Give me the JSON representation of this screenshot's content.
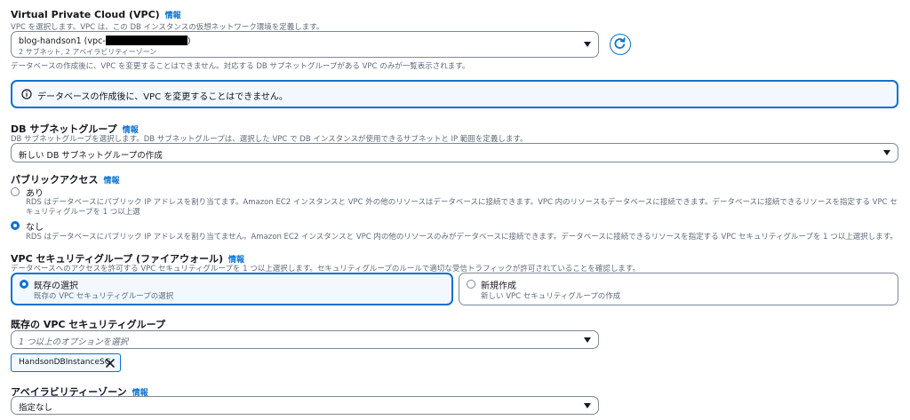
{
  "vpc": {
    "label": "Virtual Private Cloud (VPC)",
    "info": "情報",
    "description": "VPC を選択します。VPC は、この DB インスタンスの仮想ネットワーク環境を定義します。",
    "selected_value": "blog-handson1 (vpc-",
    "selected_sub": "2 サブネット, 2 アベイラビリティーゾーン",
    "footnote": "データベースの作成後に、VPC を変更することはできません。対応する DB サブネットグループがある VPC のみが一覧表示されます。"
  },
  "alert": {
    "text": "データベースの作成後に、VPC を変更することはできません。"
  },
  "subnet_group": {
    "label": "DB サブネットグループ",
    "info": "情報",
    "description": "DB サブネットグループを選択します。DB サブネットグループは、選択した VPC で DB インスタンスが使用できるサブネットと IP 範囲を定義します。",
    "value": "新しい DB サブネットグループの作成"
  },
  "public_access": {
    "label": "パブリックアクセス",
    "info": "情報",
    "options": [
      {
        "title": "あり",
        "desc": "RDS はデータベースにパブリック IP アドレスを割り当てます。Amazon EC2 インスタンスと VPC 外の他のリソースはデータベースに接続できます。VPC 内のリソースもデータベースに接続できます。データベースに接続できるリソースを指定する VPC セキュリティグループを 1 つ以上選",
        "selected": false
      },
      {
        "title": "なし",
        "desc": "RDS はデータベースにパブリック IP アドレスを割り当てません。Amazon EC2 インスタンスと VPC 内の他のリソースのみがデータベースに接続できます。データベースに接続できるリソースを指定する VPC セキュリティグループを 1 つ以上選択します。",
        "selected": true
      }
    ]
  },
  "security_group": {
    "label": "VPC セキュリティグループ (ファイアウォール)",
    "info": "情報",
    "description": "データベースへのアクセスを許可する VPC セキュリティグループを 1 つ以上選択します。セキュリティグループのルールで適切な受信トラフィックが許可されていることを確認します。",
    "tiles": [
      {
        "title": "既存の選択",
        "desc": "既存の VPC セキュリティグループの選択",
        "selected": true
      },
      {
        "title": "新規作成",
        "desc": "新しい VPC セキュリティグループの作成",
        "selected": false
      }
    ]
  },
  "existing_sg": {
    "label": "既存の VPC セキュリティグループ",
    "placeholder": "1 つ以上のオプションを選択",
    "token": "HandsonDBInstanceSG"
  },
  "az": {
    "label": "アベイラビリティーゾーン",
    "info": "情報",
    "value": "指定なし"
  },
  "colors": {
    "accent": "#0972d3",
    "info_bg": "#f2f8fd",
    "info_border": "#0972d3"
  }
}
